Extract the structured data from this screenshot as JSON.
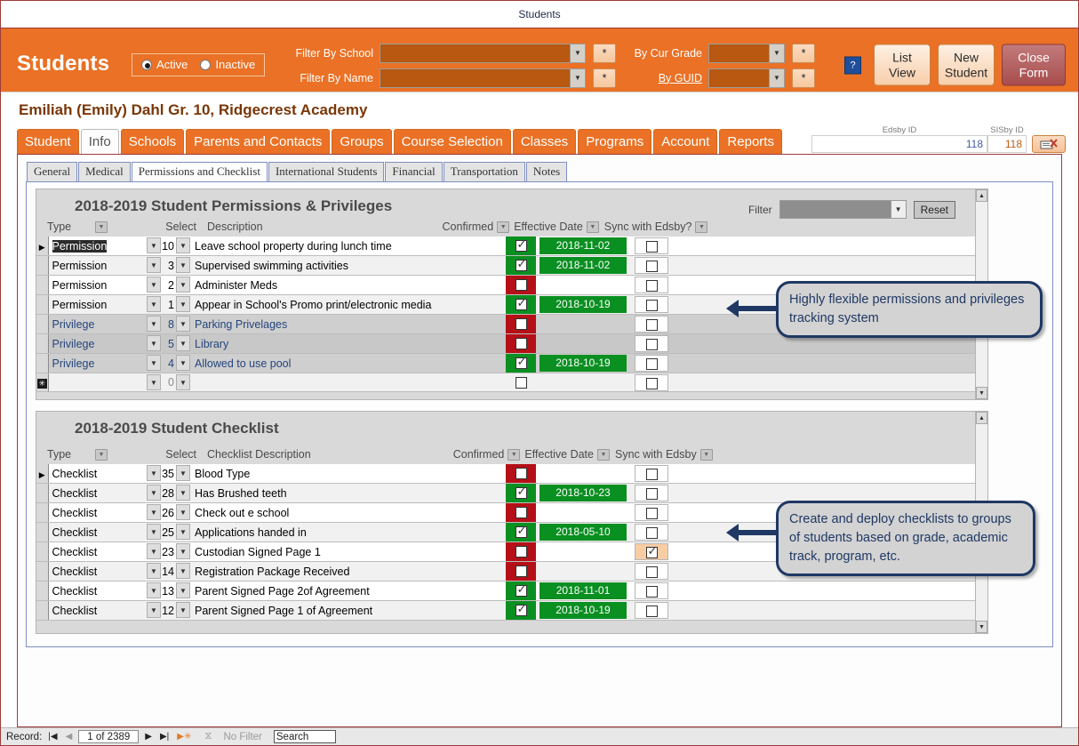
{
  "window": {
    "title": "Students"
  },
  "header": {
    "app_title": "Students",
    "status_options": [
      {
        "label": "Active",
        "selected": true
      },
      {
        "label": "Inactive",
        "selected": false
      }
    ],
    "filters": [
      {
        "label": "Filter By School",
        "value": "",
        "button": "*"
      },
      {
        "label": "Filter By Name",
        "value": "",
        "button": "*"
      }
    ],
    "filters_right": [
      {
        "label": "By Cur Grade",
        "value": "",
        "button": "*",
        "link": false
      },
      {
        "label": "By GUID",
        "value": "",
        "button": "*",
        "link": true
      }
    ],
    "help_button": "?",
    "buttons": [
      {
        "label": "List View",
        "line1": "List",
        "line2": "View"
      },
      {
        "label": "New Student",
        "line1": "New",
        "line2": "Student"
      },
      {
        "label": "Close Form",
        "line1": "Close",
        "line2": "Form"
      }
    ]
  },
  "student": {
    "name_line": "Emiliah (Emily)  Dahl  Gr. 10, Ridgecrest Academy",
    "edsby_id_caption": "Edsby ID",
    "edsby_id_value": "118",
    "sisby_id_caption": "SISby ID",
    "sisby_id_value": "118"
  },
  "main_tabs": [
    {
      "label": "Student",
      "active": false
    },
    {
      "label": "Info",
      "active": true
    },
    {
      "label": "Schools",
      "active": false
    },
    {
      "label": "Parents and Contacts",
      "active": false
    },
    {
      "label": "Groups",
      "active": false
    },
    {
      "label": "Course Selection",
      "active": false
    },
    {
      "label": "Classes",
      "active": false
    },
    {
      "label": "Programs",
      "active": false
    },
    {
      "label": "Account",
      "active": false
    },
    {
      "label": "Reports",
      "active": false
    }
  ],
  "sub_tabs": [
    {
      "label": "General",
      "active": false
    },
    {
      "label": "Medical",
      "active": false
    },
    {
      "label": "Permissions and Checklist",
      "active": true
    },
    {
      "label": "International Students",
      "active": false
    },
    {
      "label": "Financial",
      "active": false
    },
    {
      "label": "Transportation",
      "active": false
    },
    {
      "label": "Notes",
      "active": false
    }
  ],
  "permissions": {
    "title": "2018-2019 Student Permissions & Privileges",
    "filter_label": "Filter",
    "filter_value": "",
    "reset_label": "Reset",
    "columns": {
      "type": "Type",
      "select": "Select",
      "description": "Description",
      "confirmed": "Confirmed",
      "effective_date": "Effective Date",
      "sync": "Sync with Edsby?"
    },
    "rows": [
      {
        "current": true,
        "type": "Permission",
        "select": "10",
        "description": "Leave school property during lunch time",
        "confirmed": true,
        "date": "2018-11-02",
        "sync": false,
        "style": "white",
        "type_selected": true
      },
      {
        "current": false,
        "type": "Permission",
        "select": "3",
        "description": "Supervised swimming activities",
        "confirmed": true,
        "date": "2018-11-02",
        "sync": false,
        "style": "alt",
        "type_selected": false
      },
      {
        "current": false,
        "type": "Permission",
        "select": "2",
        "description": "Administer Meds",
        "confirmed": false,
        "date": "",
        "sync": false,
        "style": "white",
        "type_selected": false
      },
      {
        "current": false,
        "type": "Permission",
        "select": "1",
        "description": "Appear in School's Promo print/electronic media",
        "confirmed": true,
        "date": "2018-10-19",
        "sync": false,
        "style": "alt",
        "type_selected": false
      },
      {
        "current": false,
        "type": "Privilege",
        "select": "8",
        "description": "Parking Privelages",
        "confirmed": false,
        "date": "",
        "sync": false,
        "style": "gray",
        "type_selected": false
      },
      {
        "current": false,
        "type": "Privilege",
        "select": "5",
        "description": "Library",
        "confirmed": false,
        "date": "",
        "sync": false,
        "style": "graylt",
        "type_selected": false
      },
      {
        "current": false,
        "type": "Privilege",
        "select": "4",
        "description": "Allowed to use pool",
        "confirmed": true,
        "date": "2018-10-19",
        "sync": false,
        "style": "gray",
        "type_selected": false
      },
      {
        "current": false,
        "new": true,
        "type": "",
        "select": "0",
        "description": "",
        "confirmed": null,
        "date": "",
        "sync": false,
        "style": "alt",
        "type_selected": false
      }
    ]
  },
  "checklist": {
    "title": "2018-2019 Student Checklist",
    "columns": {
      "type": "Type",
      "select": "Select",
      "description": "Checklist Description",
      "confirmed": "Confirmed",
      "effective_date": "Effective Date",
      "sync": "Sync with Edsby"
    },
    "rows": [
      {
        "current": true,
        "type": "Checklist",
        "select": "35",
        "description": "Blood Type",
        "confirmed": false,
        "date": "",
        "sync": false,
        "style": "white"
      },
      {
        "current": false,
        "type": "Checklist",
        "select": "28",
        "description": "Has Brushed teeth",
        "confirmed": true,
        "date": "2018-10-23",
        "sync": false,
        "style": "alt"
      },
      {
        "current": false,
        "type": "Checklist",
        "select": "26",
        "description": "Check out e school",
        "confirmed": false,
        "date": "",
        "sync": false,
        "style": "white"
      },
      {
        "current": false,
        "type": "Checklist",
        "select": "25",
        "description": "Applications handed in",
        "confirmed": true,
        "date": "2018-05-10",
        "sync": false,
        "style": "alt"
      },
      {
        "current": false,
        "type": "Checklist",
        "select": "23",
        "description": "Custodian Signed Page 1",
        "confirmed": false,
        "date": "",
        "sync": true,
        "sync_highlight": true,
        "style": "white"
      },
      {
        "current": false,
        "type": "Checklist",
        "select": "14",
        "description": "Registration Package Received",
        "confirmed": false,
        "date": "",
        "sync": false,
        "style": "alt"
      },
      {
        "current": false,
        "type": "Checklist",
        "select": "13",
        "description": "Parent Signed Page 2of Agreement",
        "confirmed": true,
        "date": "2018-11-01",
        "sync": false,
        "style": "white"
      },
      {
        "current": false,
        "type": "Checklist",
        "select": "12",
        "description": "Parent Signed Page 1 of Agreement",
        "confirmed": true,
        "date": "2018-10-19",
        "sync": false,
        "style": "alt"
      }
    ]
  },
  "callouts": [
    {
      "text": "Highly flexible permissions and privileges tracking system"
    },
    {
      "text": "Create and deploy checklists to groups of students based on grade, academic track, program, etc."
    }
  ],
  "statusbar": {
    "record_label": "Record:",
    "record_value": "1 of 2389",
    "filter_label": "No Filter",
    "search_value": "Search"
  },
  "colors": {
    "accent_orange": "#ea7125",
    "confirmed_yes": "#0a8f21",
    "confirmed_no": "#b50f17",
    "callout_border": "#1f3864"
  }
}
